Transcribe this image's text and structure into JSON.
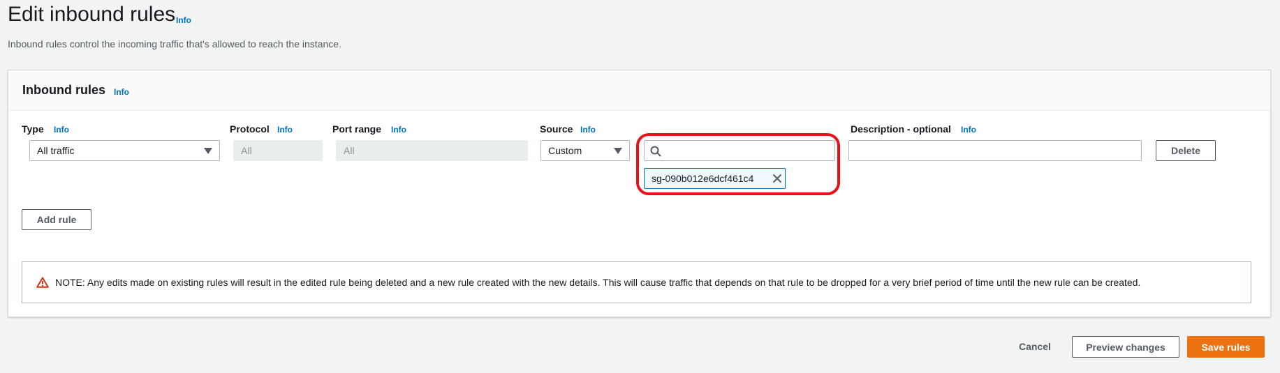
{
  "page": {
    "title": "Edit inbound rules",
    "title_info": "Info",
    "description": "Inbound rules control the incoming traffic that's allowed to reach the instance."
  },
  "panel": {
    "title": "Inbound rules",
    "title_info": "Info",
    "columns": {
      "type": {
        "label": "Type",
        "info": "Info"
      },
      "protocol": {
        "label": "Protocol",
        "info": "Info"
      },
      "port_range": {
        "label": "Port range",
        "info": "Info"
      },
      "source": {
        "label": "Source",
        "info": "Info"
      },
      "description": {
        "label": "Description - optional",
        "info": "Info"
      }
    },
    "rule": {
      "type_value": "All traffic",
      "protocol_value": "All",
      "port_range_value": "All",
      "source_value": "Custom",
      "source_search_value": "",
      "source_token": "sg-090b012e6dcf461c4",
      "description_value": "",
      "delete_label": "Delete"
    },
    "add_rule_label": "Add rule",
    "note": "NOTE: Any edits made on existing rules will result in the edited rule being deleted and a new rule created with the new details. This will cause traffic that depends on that rule to be dropped for a very brief period of time until the new rule can be created."
  },
  "footer": {
    "cancel_label": "Cancel",
    "preview_label": "Preview changes",
    "save_label": "Save rules"
  },
  "colors": {
    "primary": "#ec7211",
    "info_link": "#0073bb",
    "highlight": "#e8101a",
    "warning": "#d13212"
  },
  "icons": {
    "type_select": "caret-down-icon",
    "source_select": "caret-down-icon",
    "search": "search-icon",
    "token_remove": "close-icon",
    "warning": "warning-icon"
  }
}
